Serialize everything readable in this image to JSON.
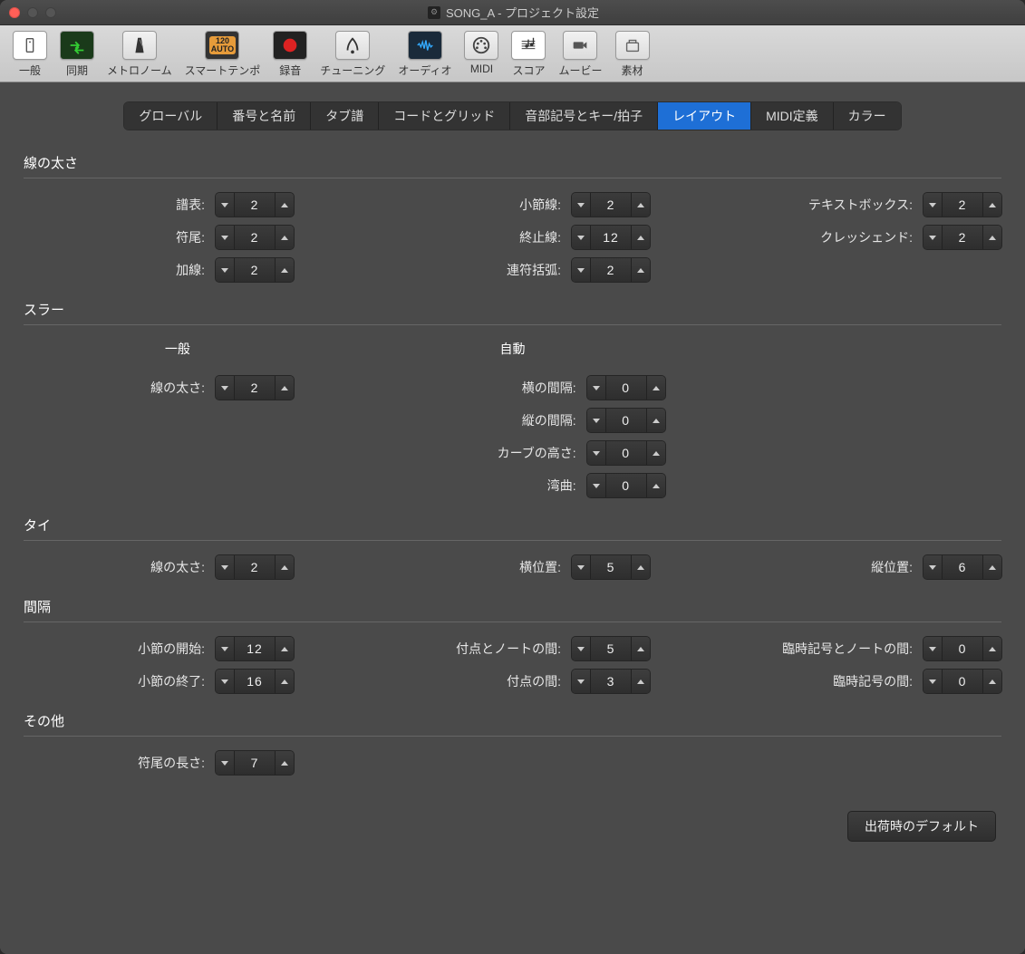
{
  "window": {
    "title": "SONG_A - プロジェクト設定"
  },
  "toolbar": {
    "items": [
      {
        "label": "一般"
      },
      {
        "label": "同期"
      },
      {
        "label": "メトロノーム"
      },
      {
        "label": "スマートテンポ"
      },
      {
        "label": "録音"
      },
      {
        "label": "チューニング"
      },
      {
        "label": "オーディオ"
      },
      {
        "label": "MIDI"
      },
      {
        "label": "スコア"
      },
      {
        "label": "ムービー"
      },
      {
        "label": "素材"
      }
    ]
  },
  "tabs": {
    "items": [
      {
        "label": "グローバル"
      },
      {
        "label": "番号と名前"
      },
      {
        "label": "タブ譜"
      },
      {
        "label": "コードとグリッド"
      },
      {
        "label": "音部記号とキー/拍子"
      },
      {
        "label": "レイアウト"
      },
      {
        "label": "MIDI定義"
      },
      {
        "label": "カラー"
      }
    ],
    "activeIndex": 5
  },
  "sections": {
    "lineThickness": {
      "title": "線の太さ",
      "staff": {
        "label": "譜表:",
        "value": "2"
      },
      "stem": {
        "label": "符尾:",
        "value": "2"
      },
      "ledger": {
        "label": "加線:",
        "value": "2"
      },
      "barline": {
        "label": "小節線:",
        "value": "2"
      },
      "finalBar": {
        "label": "終止線:",
        "value": "12"
      },
      "tuplet": {
        "label": "連符括弧:",
        "value": "2"
      },
      "textbox": {
        "label": "テキストボックス:",
        "value": "2"
      },
      "crescendo": {
        "label": "クレッシェンド:",
        "value": "2"
      }
    },
    "slur": {
      "title": "スラー",
      "generalHeader": "一般",
      "autoHeader": "自動",
      "thickness": {
        "label": "線の太さ:",
        "value": "2"
      },
      "hspace": {
        "label": "横の間隔:",
        "value": "0"
      },
      "vspace": {
        "label": "縦の間隔:",
        "value": "0"
      },
      "curveHeight": {
        "label": "カーブの高さ:",
        "value": "0"
      },
      "bend": {
        "label": "湾曲:",
        "value": "0"
      }
    },
    "tie": {
      "title": "タイ",
      "thickness": {
        "label": "線の太さ:",
        "value": "2"
      },
      "hpos": {
        "label": "横位置:",
        "value": "5"
      },
      "vpos": {
        "label": "縦位置:",
        "value": "6"
      }
    },
    "spacing": {
      "title": "間隔",
      "barStart": {
        "label": "小節の開始:",
        "value": "12"
      },
      "barEnd": {
        "label": "小節の終了:",
        "value": "16"
      },
      "dotNote": {
        "label": "付点とノートの間:",
        "value": "5"
      },
      "dotSpace": {
        "label": "付点の間:",
        "value": "3"
      },
      "accNote": {
        "label": "臨時記号とノートの間:",
        "value": "0"
      },
      "accSpace": {
        "label": "臨時記号の間:",
        "value": "0"
      }
    },
    "other": {
      "title": "その他",
      "stemLength": {
        "label": "符尾の長さ:",
        "value": "7"
      }
    }
  },
  "footer": {
    "defaultButton": "出荷時のデフォルト"
  }
}
